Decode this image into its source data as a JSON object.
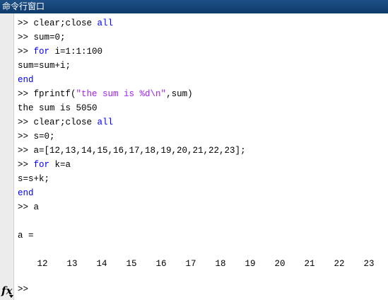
{
  "window": {
    "title": "命令行窗口"
  },
  "lines": [
    {
      "prompt": ">> ",
      "segs": [
        {
          "t": "clear;close ",
          "c": "plain"
        },
        {
          "t": "all",
          "c": "kw"
        }
      ]
    },
    {
      "prompt": ">> ",
      "segs": [
        {
          "t": "sum=0;",
          "c": "plain"
        }
      ]
    },
    {
      "prompt": ">> ",
      "segs": [
        {
          "t": "for",
          "c": "kw"
        },
        {
          "t": " i=1:1:100",
          "c": "plain"
        }
      ]
    },
    {
      "prompt": "",
      "segs": [
        {
          "t": "sum=sum+i;",
          "c": "plain"
        }
      ]
    },
    {
      "prompt": "",
      "segs": [
        {
          "t": "end",
          "c": "kw"
        }
      ]
    },
    {
      "prompt": ">> ",
      "segs": [
        {
          "t": "fprintf(",
          "c": "plain"
        },
        {
          "t": "\"the sum is %d\\n\"",
          "c": "str"
        },
        {
          "t": ",sum)",
          "c": "plain"
        }
      ]
    },
    {
      "prompt": "",
      "segs": [
        {
          "t": "the sum is 5050",
          "c": "plain"
        }
      ]
    },
    {
      "prompt": ">> ",
      "segs": [
        {
          "t": "clear;close ",
          "c": "plain"
        },
        {
          "t": "all",
          "c": "kw"
        }
      ]
    },
    {
      "prompt": ">> ",
      "segs": [
        {
          "t": "s=0;",
          "c": "plain"
        }
      ]
    },
    {
      "prompt": ">> ",
      "segs": [
        {
          "t": "a=[12,13,14,15,16,17,18,19,20,21,22,23];",
          "c": "plain"
        }
      ]
    },
    {
      "prompt": ">> ",
      "segs": [
        {
          "t": "for",
          "c": "kw"
        },
        {
          "t": " k=a",
          "c": "plain"
        }
      ]
    },
    {
      "prompt": "",
      "segs": [
        {
          "t": "s=s+k;",
          "c": "plain"
        }
      ]
    },
    {
      "prompt": "",
      "segs": [
        {
          "t": "end",
          "c": "kw"
        }
      ]
    },
    {
      "prompt": ">> ",
      "segs": [
        {
          "t": "a",
          "c": "plain"
        }
      ]
    },
    {
      "prompt": "",
      "segs": [
        {
          "t": "",
          "c": "plain"
        }
      ]
    },
    {
      "prompt": "",
      "segs": [
        {
          "t": "a =",
          "c": "plain"
        }
      ]
    },
    {
      "prompt": "",
      "segs": [
        {
          "t": "",
          "c": "plain"
        }
      ]
    }
  ],
  "output_values": [
    "12",
    "13",
    "14",
    "15",
    "16",
    "17",
    "18",
    "19",
    "20",
    "21",
    "22",
    "23"
  ],
  "command_prompt": ">>",
  "fx_icon": {
    "label": "fx",
    "name": "fx-icon"
  }
}
